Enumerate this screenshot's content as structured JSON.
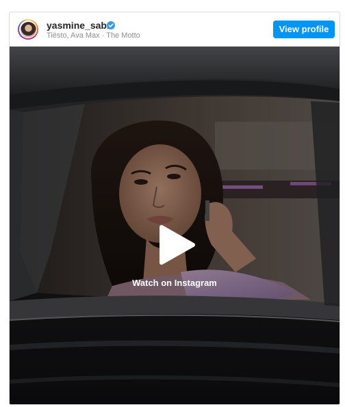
{
  "header": {
    "username": "yasmine_sabri",
    "audio": "Tiësto, Ava Max · The Motto",
    "view_profile_label": "View profile"
  },
  "media": {
    "watch_label": "Watch on Instagram"
  },
  "icons": {
    "verified": "verified-badge-icon",
    "play": "play-icon"
  },
  "colors": {
    "button_blue": "#0095f6",
    "verified_blue": "#3897f0"
  }
}
